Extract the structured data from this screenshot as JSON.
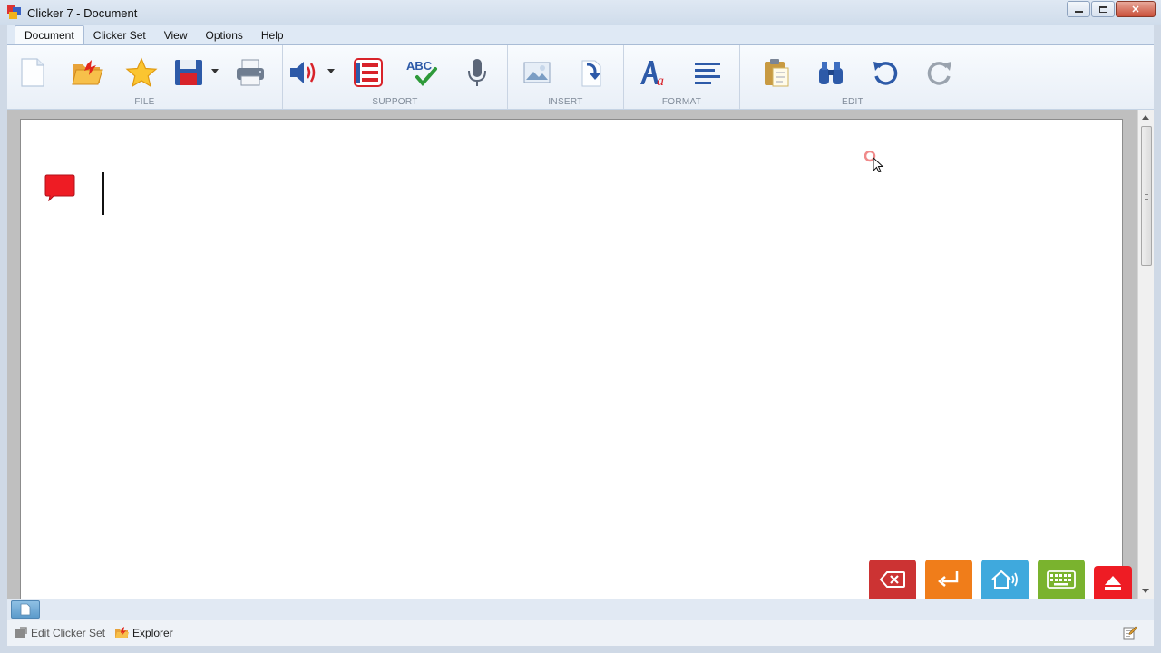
{
  "window": {
    "title": "Clicker 7 - Document",
    "controls": [
      "minimize-icon",
      "maximize-icon",
      "close-icon"
    ]
  },
  "menu": {
    "tabs": [
      {
        "label": "Document",
        "active": true
      },
      {
        "label": "Clicker Set"
      },
      {
        "label": "View"
      },
      {
        "label": "Options"
      },
      {
        "label": "Help"
      }
    ]
  },
  "ribbon": {
    "groups": [
      {
        "label": "FILE",
        "tools": [
          "new-document-icon",
          "open-folder-icon",
          "favourites-star-icon",
          "save-disk-icon",
          "print-icon"
        ]
      },
      {
        "label": "SUPPORT",
        "tools": [
          "speaker-icon",
          "word-list-icon",
          "spell-check-icon",
          "microphone-icon"
        ]
      },
      {
        "label": "INSERT",
        "tools": [
          "insert-picture-icon",
          "insert-file-icon"
        ]
      },
      {
        "label": "FORMAT",
        "tools": [
          "font-style-icon",
          "align-left-icon"
        ]
      },
      {
        "label": "EDIT",
        "tools": [
          "paste-clipboard-icon",
          "find-binoculars-icon",
          "undo-icon",
          "redo-icon"
        ]
      }
    ],
    "spell_check_text": "ABC"
  },
  "action_buttons": [
    {
      "name": "backspace",
      "icon": "backspace-icon",
      "color": "#cc3333"
    },
    {
      "name": "enter",
      "icon": "return-arrow-icon",
      "color": "#f07d1a"
    },
    {
      "name": "speak",
      "icon": "speak-house-icon",
      "color": "#3fa9dd"
    },
    {
      "name": "keyboard",
      "icon": "keyboard-icon",
      "color": "#7ab32e"
    },
    {
      "name": "hide-grid",
      "icon": "eject-icon",
      "color": "#ee1c24"
    }
  ],
  "statusbar": {
    "edit_clicker_set": "Edit Clicker Set",
    "explorer": "Explorer"
  },
  "colors": {
    "note_marker": "#ee1c24",
    "ribbon_icon_blue": "#2d5aa8"
  }
}
